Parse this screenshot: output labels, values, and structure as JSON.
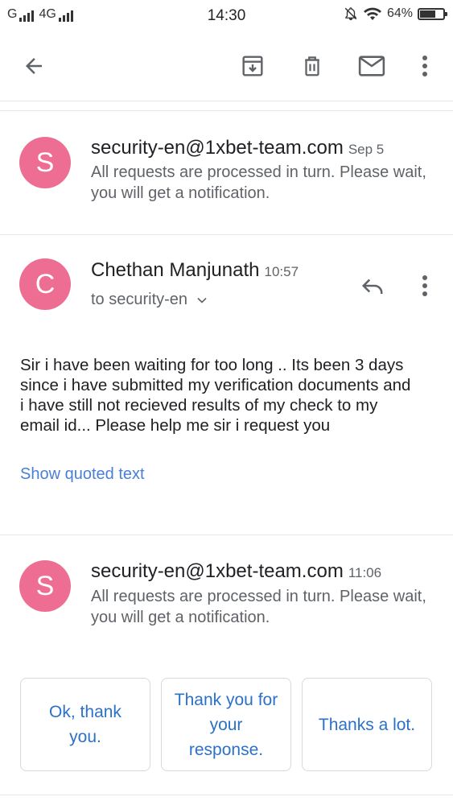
{
  "status_bar": {
    "carrier_left": "G",
    "network": "4G",
    "time": "14:30",
    "battery": "64%"
  },
  "toolbar": {
    "icons": [
      "back-arrow-icon",
      "archive-icon",
      "delete-icon",
      "mark-unread-icon",
      "more-vert-icon"
    ]
  },
  "messages": [
    {
      "avatar_letter": "S",
      "sender": "security-en@1xbet-team.com",
      "date": "Sep 5",
      "snippet": "All requests are processed in turn. Please wait, you will get a notification."
    },
    {
      "avatar_letter": "C",
      "sender": "Chethan Manjunath",
      "date": "10:57",
      "to": "to security-en",
      "body": "Sir i have been waiting for too long .. Its been 3 days\nsince i have submitted my verification documents and\ni have still not recieved results of my check to my\nemail id... Please help me sir i request you",
      "show_quoted": "Show quoted text"
    },
    {
      "avatar_letter": "S",
      "sender": "security-en@1xbet-team.com",
      "date": "11:06",
      "snippet": "All requests are processed in turn. Please wait, you will get a notification."
    }
  ],
  "smart_replies": [
    "Ok, thank you.",
    "Thank you for your response.",
    "Thanks a lot."
  ],
  "colors": {
    "avatar": "#ee6e93",
    "link": "#4a7fd6",
    "chip_text": "#2b71c8"
  }
}
